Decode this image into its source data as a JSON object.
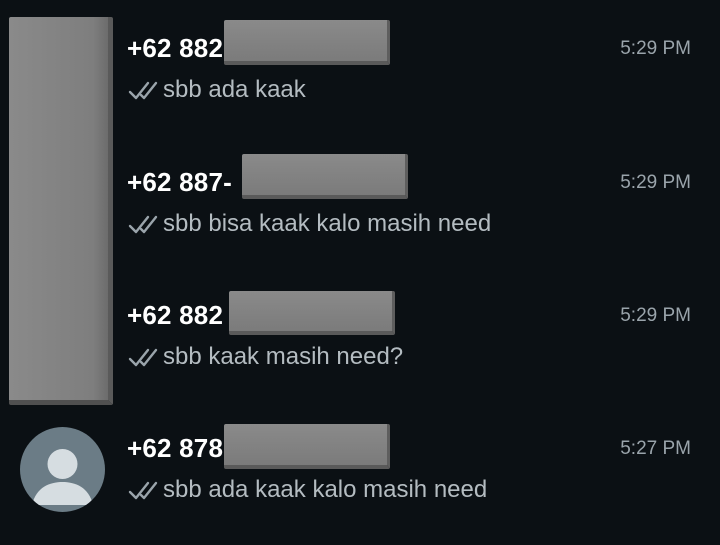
{
  "chats": [
    {
      "name": "+62 882",
      "time": "5:29 PM",
      "preview": "sbb ada kaak",
      "status_icon": "double-check-icon"
    },
    {
      "name": "+62 887-",
      "time": "5:29 PM",
      "preview": "sbb bisa kaak kalo masih need",
      "status_icon": "double-check-icon"
    },
    {
      "name": "+62 882",
      "time": "5:29 PM",
      "preview": "sbb kaak masih need?",
      "status_icon": "double-check-icon"
    },
    {
      "name": "+62 878",
      "time": "5:27 PM",
      "preview": "sbb ada kaak kalo masih need",
      "status_icon": "double-check-icon",
      "avatar_icon": "default-profile-icon"
    }
  ],
  "colors": {
    "background": "#0b1014",
    "name_text": "#ffffff",
    "time_text": "#9aa4ab",
    "preview_text": "#b4bcc1",
    "tick": "#9aa4ab",
    "avatar_bg": "#6b7c86",
    "avatar_fg": "#d6dde1",
    "redaction": "#808080"
  }
}
